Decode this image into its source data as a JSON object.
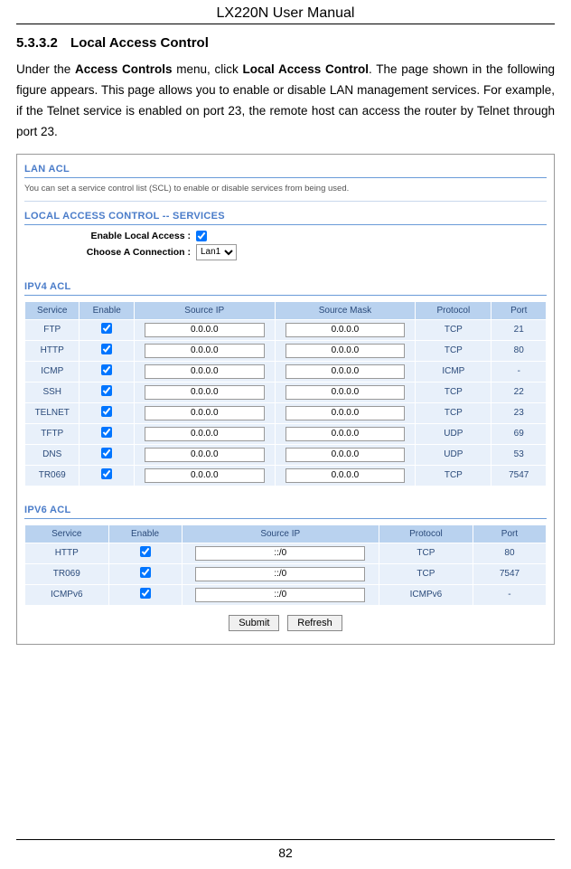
{
  "header": {
    "title": "LX220N User Manual"
  },
  "section": {
    "number": "5.3.3.2",
    "title": "Local Access Control"
  },
  "paragraph": {
    "pre": "Under the ",
    "b1": "Access Controls",
    "mid1": " menu, click ",
    "b2": "Local Access Control",
    "post": ". The page shown in the following figure appears. This page allows you to enable or disable LAN management services. For example, if the Telnet service is enabled on port 23, the remote host can access the router by Telnet through port 23."
  },
  "figure": {
    "lan_acl": {
      "heading": "LAN ACL",
      "desc": "You can set a service control list (SCL) to enable or disable services from being used."
    },
    "services": {
      "heading": "LOCAL ACCESS CONTROL -- SERVICES",
      "enable_label": "Enable Local Access :",
      "choose_label": "Choose A Connection :",
      "connection_value": "Lan1"
    },
    "ipv4": {
      "heading": "IPV4 ACL",
      "headers": {
        "service": "Service",
        "enable": "Enable",
        "source_ip": "Source IP",
        "source_mask": "Source Mask",
        "protocol": "Protocol",
        "port": "Port"
      },
      "rows": [
        {
          "service": "FTP",
          "enable": true,
          "source_ip": "0.0.0.0",
          "source_mask": "0.0.0.0",
          "protocol": "TCP",
          "port": "21"
        },
        {
          "service": "HTTP",
          "enable": true,
          "source_ip": "0.0.0.0",
          "source_mask": "0.0.0.0",
          "protocol": "TCP",
          "port": "80"
        },
        {
          "service": "ICMP",
          "enable": true,
          "source_ip": "0.0.0.0",
          "source_mask": "0.0.0.0",
          "protocol": "ICMP",
          "port": "-"
        },
        {
          "service": "SSH",
          "enable": true,
          "source_ip": "0.0.0.0",
          "source_mask": "0.0.0.0",
          "protocol": "TCP",
          "port": "22"
        },
        {
          "service": "TELNET",
          "enable": true,
          "source_ip": "0.0.0.0",
          "source_mask": "0.0.0.0",
          "protocol": "TCP",
          "port": "23"
        },
        {
          "service": "TFTP",
          "enable": true,
          "source_ip": "0.0.0.0",
          "source_mask": "0.0.0.0",
          "protocol": "UDP",
          "port": "69"
        },
        {
          "service": "DNS",
          "enable": true,
          "source_ip": "0.0.0.0",
          "source_mask": "0.0.0.0",
          "protocol": "UDP",
          "port": "53"
        },
        {
          "service": "TR069",
          "enable": true,
          "source_ip": "0.0.0.0",
          "source_mask": "0.0.0.0",
          "protocol": "TCP",
          "port": "7547"
        }
      ]
    },
    "ipv6": {
      "heading": "IPV6 ACL",
      "headers": {
        "service": "Service",
        "enable": "Enable",
        "source_ip": "Source IP",
        "protocol": "Protocol",
        "port": "Port"
      },
      "rows": [
        {
          "service": "HTTP",
          "enable": true,
          "source_ip": "::/0",
          "protocol": "TCP",
          "port": "80"
        },
        {
          "service": "TR069",
          "enable": true,
          "source_ip": "::/0",
          "protocol": "TCP",
          "port": "7547"
        },
        {
          "service": "ICMPv6",
          "enable": true,
          "source_ip": "::/0",
          "protocol": "ICMPv6",
          "port": "-"
        }
      ]
    },
    "buttons": {
      "submit": "Submit",
      "refresh": "Refresh"
    }
  },
  "page_number": "82"
}
